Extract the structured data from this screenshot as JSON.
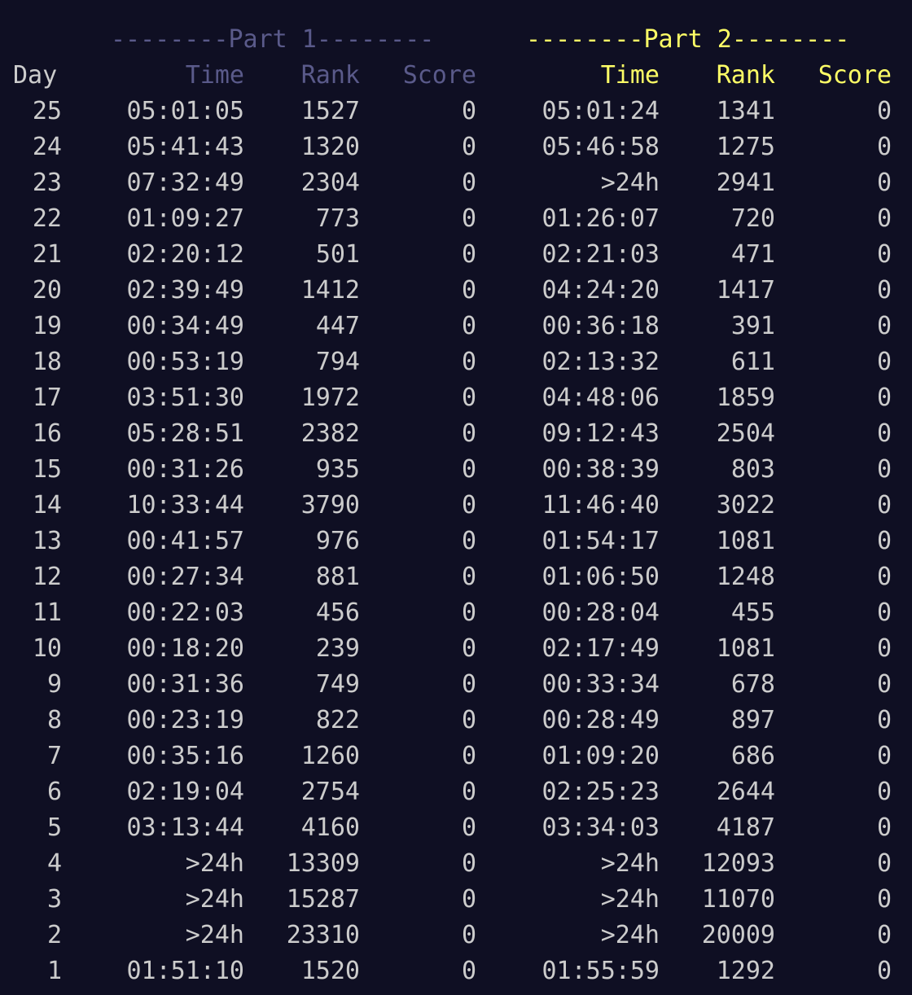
{
  "header": {
    "part1_title": "--------Part 1--------",
    "part2_title": "--------Part 2--------",
    "day_label": "Day",
    "time_label": "Time",
    "rank_label": "Rank",
    "score_label": "Score"
  },
  "colors": {
    "background": "#0f0f23",
    "text": "#cccccc",
    "part1_header": "#5a5a8a",
    "part2_header": "#ffff66"
  },
  "rows": [
    {
      "day": "25",
      "t1": "05:01:05",
      "r1": "1527",
      "s1": "0",
      "t2": "05:01:24",
      "r2": "1341",
      "s2": "0"
    },
    {
      "day": "24",
      "t1": "05:41:43",
      "r1": "1320",
      "s1": "0",
      "t2": "05:46:58",
      "r2": "1275",
      "s2": "0"
    },
    {
      "day": "23",
      "t1": "07:32:49",
      "r1": "2304",
      "s1": "0",
      "t2": ">24h",
      "r2": "2941",
      "s2": "0"
    },
    {
      "day": "22",
      "t1": "01:09:27",
      "r1": "773",
      "s1": "0",
      "t2": "01:26:07",
      "r2": "720",
      "s2": "0"
    },
    {
      "day": "21",
      "t1": "02:20:12",
      "r1": "501",
      "s1": "0",
      "t2": "02:21:03",
      "r2": "471",
      "s2": "0"
    },
    {
      "day": "20",
      "t1": "02:39:49",
      "r1": "1412",
      "s1": "0",
      "t2": "04:24:20",
      "r2": "1417",
      "s2": "0"
    },
    {
      "day": "19",
      "t1": "00:34:49",
      "r1": "447",
      "s1": "0",
      "t2": "00:36:18",
      "r2": "391",
      "s2": "0"
    },
    {
      "day": "18",
      "t1": "00:53:19",
      "r1": "794",
      "s1": "0",
      "t2": "02:13:32",
      "r2": "611",
      "s2": "0"
    },
    {
      "day": "17",
      "t1": "03:51:30",
      "r1": "1972",
      "s1": "0",
      "t2": "04:48:06",
      "r2": "1859",
      "s2": "0"
    },
    {
      "day": "16",
      "t1": "05:28:51",
      "r1": "2382",
      "s1": "0",
      "t2": "09:12:43",
      "r2": "2504",
      "s2": "0"
    },
    {
      "day": "15",
      "t1": "00:31:26",
      "r1": "935",
      "s1": "0",
      "t2": "00:38:39",
      "r2": "803",
      "s2": "0"
    },
    {
      "day": "14",
      "t1": "10:33:44",
      "r1": "3790",
      "s1": "0",
      "t2": "11:46:40",
      "r2": "3022",
      "s2": "0"
    },
    {
      "day": "13",
      "t1": "00:41:57",
      "r1": "976",
      "s1": "0",
      "t2": "01:54:17",
      "r2": "1081",
      "s2": "0"
    },
    {
      "day": "12",
      "t1": "00:27:34",
      "r1": "881",
      "s1": "0",
      "t2": "01:06:50",
      "r2": "1248",
      "s2": "0"
    },
    {
      "day": "11",
      "t1": "00:22:03",
      "r1": "456",
      "s1": "0",
      "t2": "00:28:04",
      "r2": "455",
      "s2": "0"
    },
    {
      "day": "10",
      "t1": "00:18:20",
      "r1": "239",
      "s1": "0",
      "t2": "02:17:49",
      "r2": "1081",
      "s2": "0"
    },
    {
      "day": "9",
      "t1": "00:31:36",
      "r1": "749",
      "s1": "0",
      "t2": "00:33:34",
      "r2": "678",
      "s2": "0"
    },
    {
      "day": "8",
      "t1": "00:23:19",
      "r1": "822",
      "s1": "0",
      "t2": "00:28:49",
      "r2": "897",
      "s2": "0"
    },
    {
      "day": "7",
      "t1": "00:35:16",
      "r1": "1260",
      "s1": "0",
      "t2": "01:09:20",
      "r2": "686",
      "s2": "0"
    },
    {
      "day": "6",
      "t1": "02:19:04",
      "r1": "2754",
      "s1": "0",
      "t2": "02:25:23",
      "r2": "2644",
      "s2": "0"
    },
    {
      "day": "5",
      "t1": "03:13:44",
      "r1": "4160",
      "s1": "0",
      "t2": "03:34:03",
      "r2": "4187",
      "s2": "0"
    },
    {
      "day": "4",
      "t1": ">24h",
      "r1": "13309",
      "s1": "0",
      "t2": ">24h",
      "r2": "12093",
      "s2": "0"
    },
    {
      "day": "3",
      "t1": ">24h",
      "r1": "15287",
      "s1": "0",
      "t2": ">24h",
      "r2": "11070",
      "s2": "0"
    },
    {
      "day": "2",
      "t1": ">24h",
      "r1": "23310",
      "s1": "0",
      "t2": ">24h",
      "r2": "20009",
      "s2": "0"
    },
    {
      "day": "1",
      "t1": "01:51:10",
      "r1": "1520",
      "s1": "0",
      "t2": "01:55:59",
      "r2": "1292",
      "s2": "0"
    }
  ]
}
